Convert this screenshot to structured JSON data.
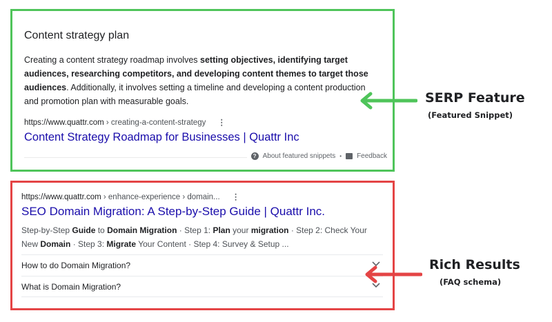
{
  "featured_snippet": {
    "title": "Content strategy plan",
    "body_plain_1": "Creating a content strategy roadmap involves ",
    "body_bold": "setting objectives, identifying target audiences, researching competitors, and developing content themes to target those audiences",
    "body_plain_2": ". Additionally, it involves setting a timeline and developing a content production and promotion plan with measurable goals.",
    "url": "https://www.quattr.com",
    "breadcrumb": " › creating-a-content-strategy",
    "link_title": "Content Strategy Roadmap for Businesses | Quattr Inc",
    "about_label": "About featured snippets",
    "separator": "•",
    "feedback_label": "Feedback",
    "border_color": "#4fc45a"
  },
  "rich_result": {
    "url": "https://www.quattr.com",
    "breadcrumb": " › enhance-experience › domain...",
    "link_title": "SEO Domain Migration: A Step-by-Step Guide | Quattr Inc.",
    "desc_parts": [
      "Step-by-Step ",
      "Guide",
      " to ",
      "Domain Migration",
      " · Step 1: ",
      "Plan",
      " your ",
      "migration",
      " · Step 2: Check Your New ",
      "Domain",
      " · Step 3: ",
      "Migrate",
      " Your Content · Step 4: Survey & Setup ..."
    ],
    "faq": [
      {
        "question": "How to do Domain Migration?"
      },
      {
        "question": "What is Domain Migration?"
      }
    ],
    "border_color": "#e44445"
  },
  "annotations": {
    "serp_title": "SERP Feature",
    "serp_sub": "(Featured Snippet)",
    "rich_title": "Rich Results",
    "rich_sub": "(FAQ schema)",
    "green": "#4fc45a",
    "red": "#e44445"
  },
  "icons": [
    "kebab-menu-icon",
    "help-icon",
    "feedback-icon",
    "chevron-down-icon",
    "arrow-left-icon"
  ],
  "link_color": "#1a0dab"
}
